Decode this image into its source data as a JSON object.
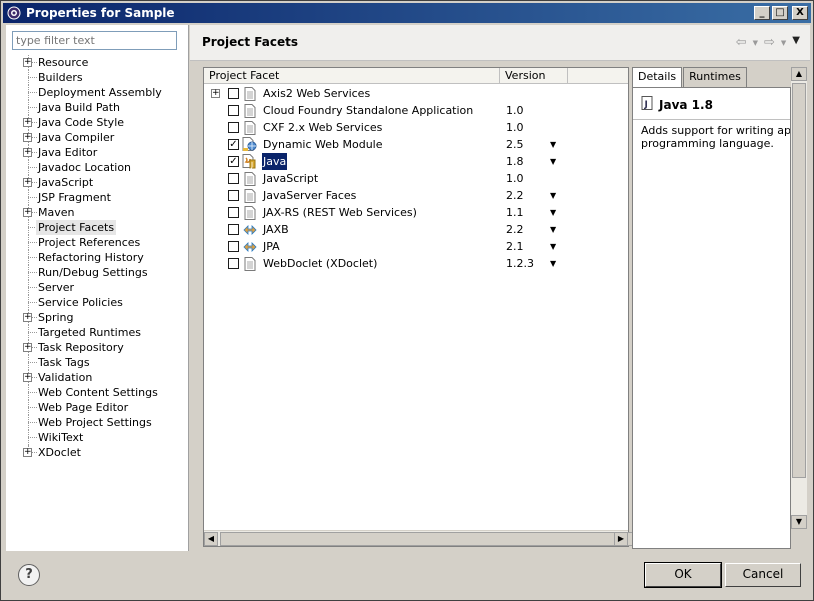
{
  "window": {
    "title": "Properties for Sample",
    "minimize": "_",
    "maximize": "□",
    "close": "X"
  },
  "filter": {
    "placeholder": "type filter text",
    "value": ""
  },
  "tree": [
    {
      "label": "Resource",
      "expandable": true
    },
    {
      "label": "Builders",
      "expandable": false
    },
    {
      "label": "Deployment Assembly",
      "expandable": false
    },
    {
      "label": "Java Build Path",
      "expandable": false
    },
    {
      "label": "Java Code Style",
      "expandable": true
    },
    {
      "label": "Java Compiler",
      "expandable": true
    },
    {
      "label": "Java Editor",
      "expandable": true
    },
    {
      "label": "Javadoc Location",
      "expandable": false
    },
    {
      "label": "JavaScript",
      "expandable": true
    },
    {
      "label": "JSP Fragment",
      "expandable": false
    },
    {
      "label": "Maven",
      "expandable": true
    },
    {
      "label": "Project Facets",
      "expandable": false,
      "selected": true
    },
    {
      "label": "Project References",
      "expandable": false
    },
    {
      "label": "Refactoring History",
      "expandable": false
    },
    {
      "label": "Run/Debug Settings",
      "expandable": false
    },
    {
      "label": "Server",
      "expandable": false
    },
    {
      "label": "Service Policies",
      "expandable": false
    },
    {
      "label": "Spring",
      "expandable": true
    },
    {
      "label": "Targeted Runtimes",
      "expandable": false
    },
    {
      "label": "Task Repository",
      "expandable": true
    },
    {
      "label": "Task Tags",
      "expandable": false
    },
    {
      "label": "Validation",
      "expandable": true
    },
    {
      "label": "Web Content Settings",
      "expandable": false
    },
    {
      "label": "Web Page Editor",
      "expandable": false
    },
    {
      "label": "Web Project Settings",
      "expandable": false
    },
    {
      "label": "WikiText",
      "expandable": false
    },
    {
      "label": "XDoclet",
      "expandable": true
    }
  ],
  "page": {
    "title": "Project Facets"
  },
  "table": {
    "headers": [
      "Project Facet",
      "Version"
    ],
    "rows": [
      {
        "name": "Axis2 Web Services",
        "version": "",
        "checked": false,
        "expandable": true,
        "icon": "page-icon",
        "dropdown": false
      },
      {
        "name": "Cloud Foundry Standalone Application",
        "version": "1.0",
        "checked": false,
        "icon": "page-icon",
        "dropdown": false
      },
      {
        "name": "CXF 2.x Web Services",
        "version": "1.0",
        "checked": false,
        "icon": "page-icon",
        "dropdown": false
      },
      {
        "name": "Dynamic Web Module",
        "version": "2.5",
        "checked": true,
        "icon": "web-module-icon",
        "dropdown": true
      },
      {
        "name": "Java",
        "version": "1.8",
        "checked": true,
        "icon": "java-icon",
        "dropdown": true,
        "selected": true
      },
      {
        "name": "JavaScript",
        "version": "1.0",
        "checked": false,
        "icon": "page-icon",
        "dropdown": false
      },
      {
        "name": "JavaServer Faces",
        "version": "2.2",
        "checked": false,
        "icon": "page-icon",
        "dropdown": true
      },
      {
        "name": "JAX-RS (REST Web Services)",
        "version": "1.1",
        "checked": false,
        "icon": "page-icon",
        "dropdown": true
      },
      {
        "name": "JAXB",
        "version": "2.2",
        "checked": false,
        "icon": "arrows-icon",
        "dropdown": true
      },
      {
        "name": "JPA",
        "version": "2.1",
        "checked": false,
        "icon": "arrows-icon",
        "dropdown": true
      },
      {
        "name": "WebDoclet (XDoclet)",
        "version": "1.2.3",
        "checked": false,
        "icon": "page-icon",
        "dropdown": true
      }
    ]
  },
  "details": {
    "tabs": [
      "Details",
      "Runtimes"
    ],
    "title": "Java 1.8",
    "description": "Adds support for writing appl\nprogramming language."
  },
  "buttons": {
    "help": "?",
    "ok": "OK",
    "cancel": "Cancel"
  },
  "icons": {
    "nav_back": "⇦",
    "nav_forward": "⇨",
    "menu": "▼",
    "dropdown": "▼"
  }
}
